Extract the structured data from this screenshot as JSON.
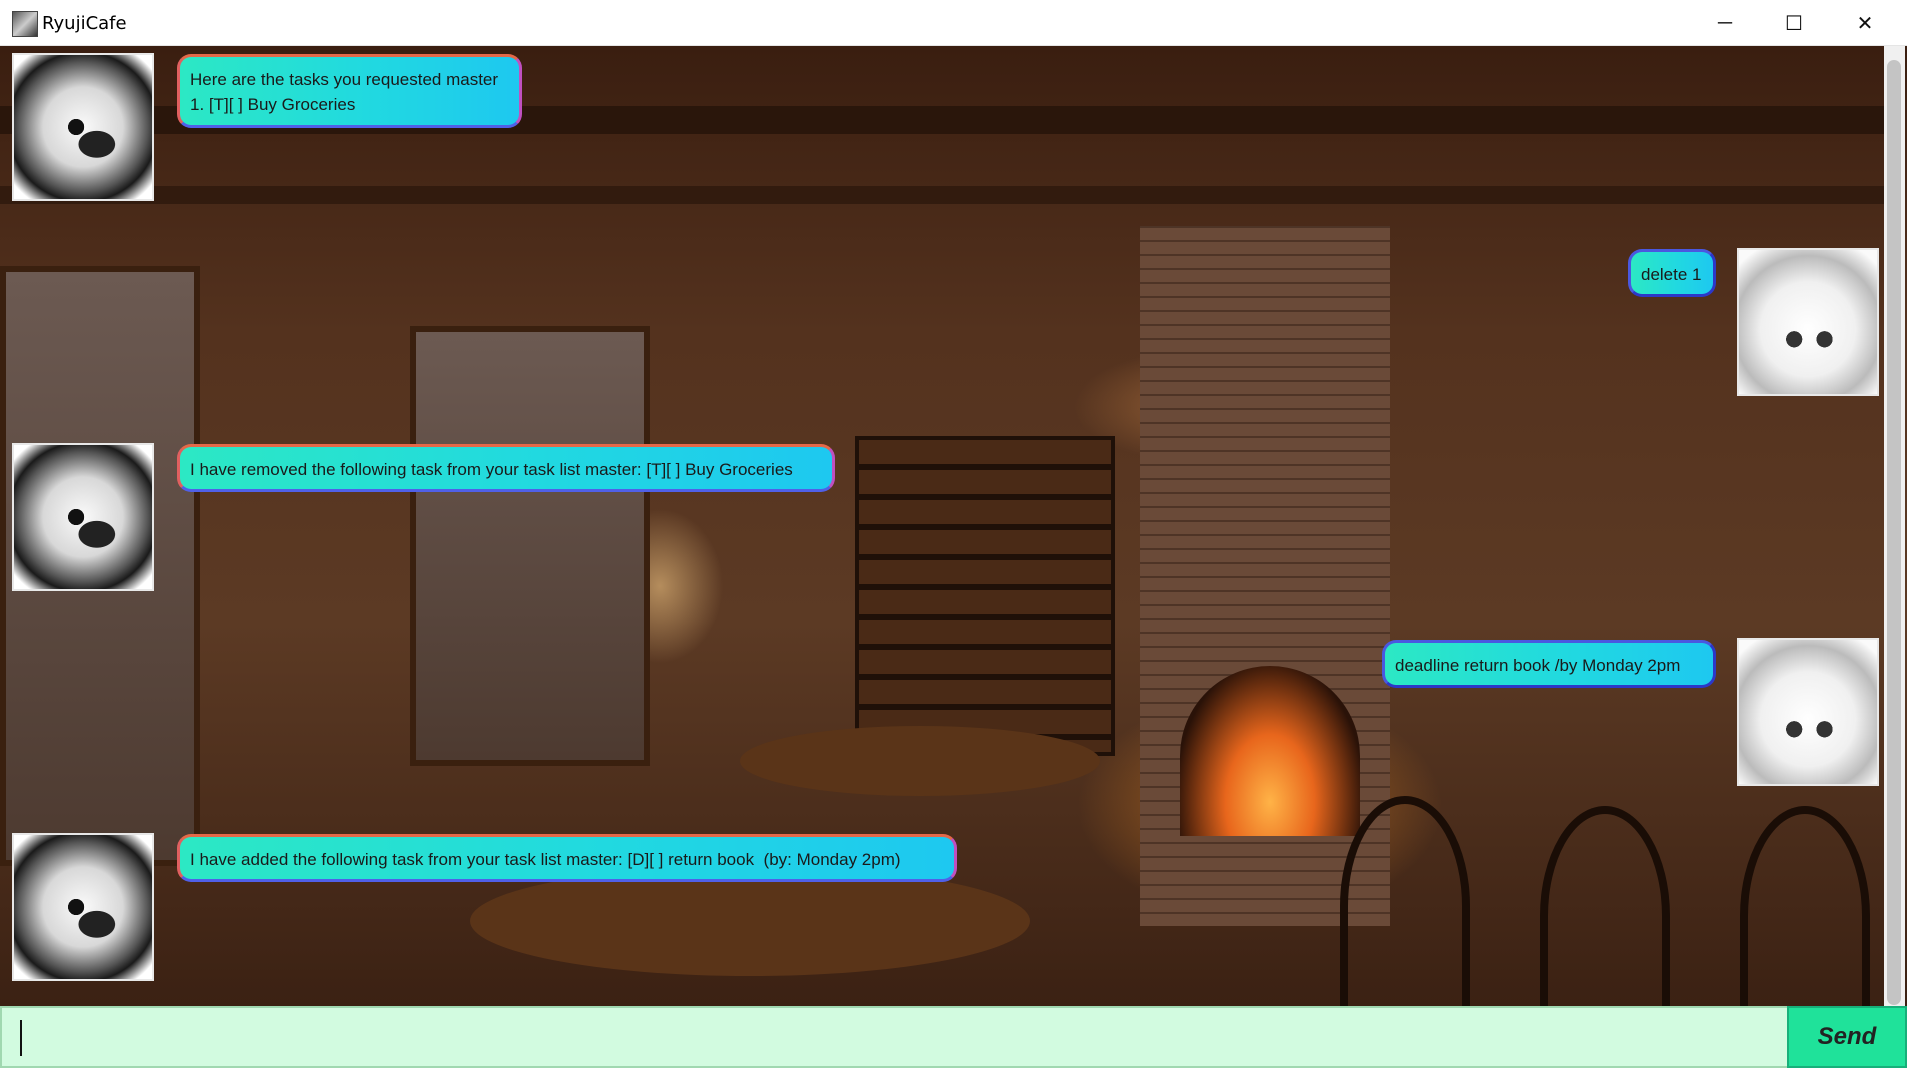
{
  "window": {
    "title": "RyujiCafe",
    "minimize_glyph": "─",
    "maximize_glyph": "☐",
    "close_glyph": "✕"
  },
  "messages": [
    {
      "sender": "bot",
      "avatar": "ryuji-avatar",
      "text": "Here are the tasks you requested master\n1. [T][ ] Buy Groceries"
    },
    {
      "sender": "user",
      "avatar": "user-avatar",
      "text": "delete 1"
    },
    {
      "sender": "bot",
      "avatar": "ryuji-avatar",
      "text": "I have removed the following task from your task list master: [T][ ] Buy Groceries"
    },
    {
      "sender": "user",
      "avatar": "user-avatar",
      "text": "deadline return book /by Monday 2pm"
    },
    {
      "sender": "bot",
      "avatar": "ryuji-avatar",
      "text": "I have added the following task from your task list master: [D][ ] return book  (by: Monday 2pm)"
    }
  ],
  "input": {
    "value": "",
    "placeholder": ""
  },
  "send_button": {
    "label": "Send"
  },
  "colors": {
    "bubble_gradient_start": "#2ce8c4",
    "bubble_gradient_end": "#1ec8f0",
    "input_background": "#d2fbe0",
    "send_button_background": "#1fe29a"
  }
}
